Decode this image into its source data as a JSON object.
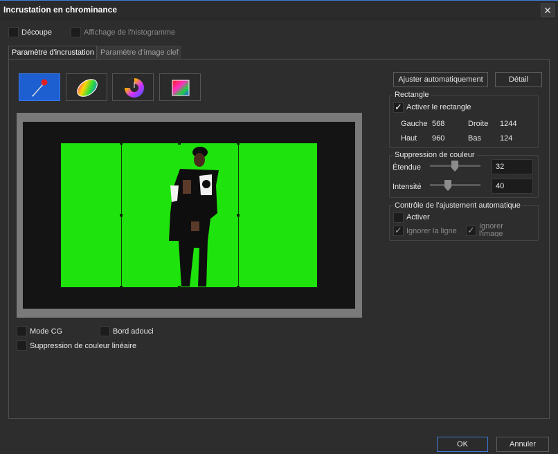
{
  "window": {
    "title": "Incrustation en chrominance",
    "close_label": "✕"
  },
  "top_options": {
    "decoupe": {
      "label": "Découpe",
      "checked": false
    },
    "histogram": {
      "label": "Affichage de l'histogramme",
      "checked": false,
      "disabled": true
    }
  },
  "tabs": [
    {
      "label": "Paramètre d'incrustation",
      "active": true
    },
    {
      "label": "Paramètre d'image clef",
      "active": false
    }
  ],
  "tools": [
    {
      "name": "eyedropper-icon",
      "active": true
    },
    {
      "name": "color-ellipse-icon",
      "active": false
    },
    {
      "name": "color-wheel-icon",
      "active": false
    },
    {
      "name": "color-square-icon",
      "active": false
    }
  ],
  "buttons": {
    "auto_adjust": "Ajuster automatiquement",
    "detail": "Détail",
    "ok": "OK",
    "cancel": "Annuler"
  },
  "rectangle": {
    "title": "Rectangle",
    "enable_label": "Activer le rectangle",
    "enabled": true,
    "left_label": "Gauche",
    "left_value": "568",
    "right_label": "Droite",
    "right_value": "1244",
    "top_label": "Haut",
    "top_value": "960",
    "bottom_label": "Bas",
    "bottom_value": "124"
  },
  "color_suppression": {
    "title": "Suppression de couleur",
    "range_label": "Étendue",
    "range_value": "32",
    "range_level": 0.45,
    "intensity_label": "Intensité",
    "intensity_value": "40",
    "intensity_level": 0.3
  },
  "auto_control": {
    "title": "Contrôle de l'ajustement automatique",
    "enable_label": "Activer",
    "ignore_line_label": "Ignorer la ligne",
    "ignore_image_label": "Ignorer l'image"
  },
  "bottom_options": {
    "cg_mode": "Mode CG",
    "soft_edge": "Bord adouci",
    "linear_suppression": "Suppression de couleur linéaire"
  }
}
